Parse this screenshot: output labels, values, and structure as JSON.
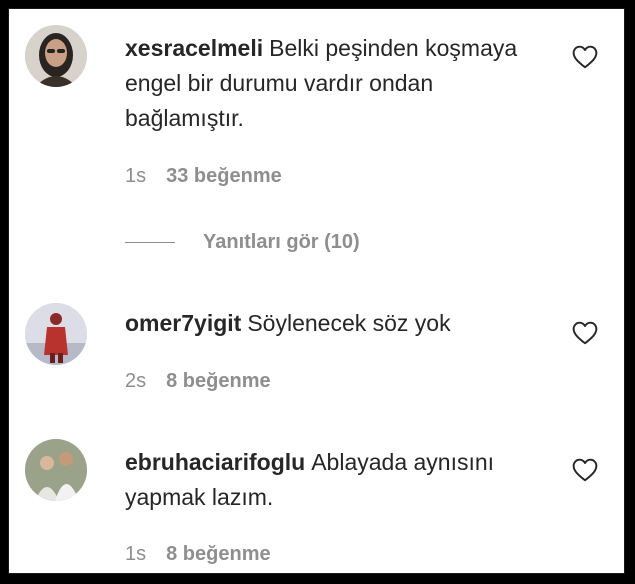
{
  "comments": [
    {
      "username": "xesracelmeli",
      "text": "Belki peşinden koşmaya engel bir durumu vardır ondan bağlamıştır.",
      "time": "1s",
      "likes": "33 beğenme",
      "avatar_icon": "avatar-woman-photo",
      "replies_label": "Yanıtları gör (10)"
    },
    {
      "username": "omer7yigit",
      "text": "Söylenecek söz yok",
      "time": "2s",
      "likes": "8 beğenme",
      "avatar_icon": "avatar-figure-photo"
    },
    {
      "username": "ebruhaciarifoglu",
      "text": "Ablayada aynısını yapmak lazım.",
      "time": "1s",
      "likes": "8 beğenme",
      "avatar_icon": "avatar-couple-photo"
    }
  ],
  "icons": {
    "like": "heart-outline-icon"
  },
  "colors": {
    "text": "#262626",
    "secondary": "#8e8e8e",
    "background": "#ffffff",
    "border": "#000000"
  }
}
